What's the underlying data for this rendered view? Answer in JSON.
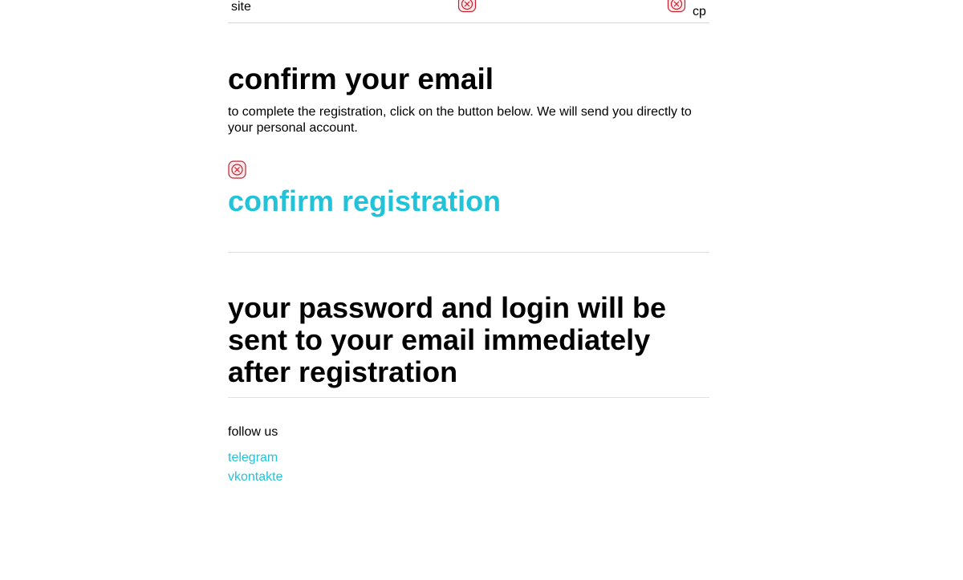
{
  "header": {
    "site_label": "site",
    "cp_label": "cp"
  },
  "icons": {
    "broken_image": "broken-image-icon"
  },
  "main": {
    "title": "confirm your email",
    "intro": "to complete the registration, click on the button below. We will send you directly to your personal account.",
    "confirm_label": "confirm registration",
    "password_notice": "your password and login will be sent to your email immediately after registration"
  },
  "footer": {
    "follow_label": "follow us",
    "links": [
      {
        "label": "telegram"
      },
      {
        "label": "vkontakte"
      }
    ]
  },
  "colors": {
    "accent": "#22c3d8",
    "broken_icon": "#c8202e"
  }
}
